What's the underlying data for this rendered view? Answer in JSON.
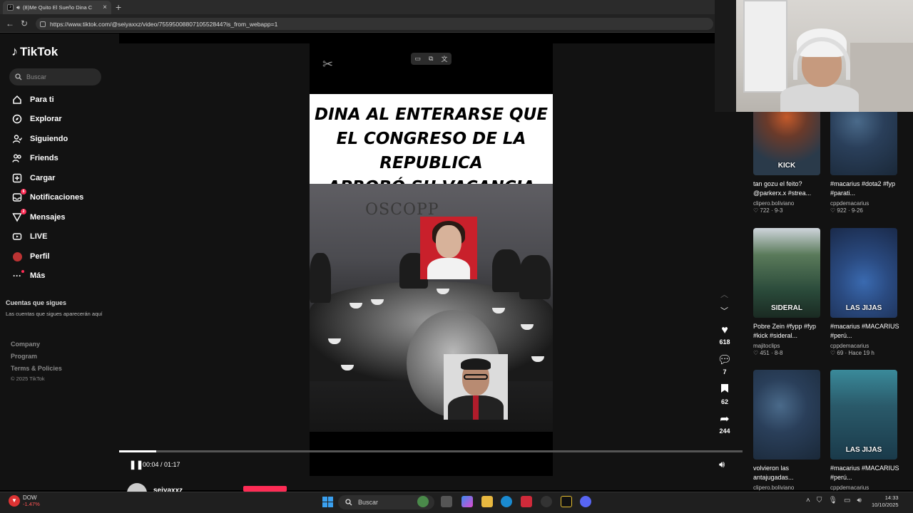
{
  "browser": {
    "tab_title": "(8)Me Quito El Sueño Dina C",
    "url": "https://www.tiktok.com/@seiyaxxz/video/7559500880710552844?is_from_webapp=1"
  },
  "sidebar": {
    "logo": "TikTok",
    "search_placeholder": "Buscar",
    "items": [
      {
        "label": "Para ti",
        "icon": "home-icon"
      },
      {
        "label": "Explorar",
        "icon": "compass-icon"
      },
      {
        "label": "Siguiendo",
        "icon": "following-icon"
      },
      {
        "label": "Friends",
        "icon": "friends-icon"
      },
      {
        "label": "Cargar",
        "icon": "upload-icon"
      },
      {
        "label": "Notificaciones",
        "icon": "inbox-icon",
        "badge": "6"
      },
      {
        "label": "Mensajes",
        "icon": "message-icon",
        "badge": "2"
      },
      {
        "label": "LIVE",
        "icon": "live-icon"
      },
      {
        "label": "Perfil",
        "icon": "avatar-icon"
      },
      {
        "label": "Más",
        "icon": "more-icon"
      }
    ],
    "following_title": "Cuentas que sigues",
    "following_note": "Las cuentas que sigues aparecerán aquí",
    "footer": [
      "Company",
      "Program",
      "Terms & Policies"
    ],
    "copyright": "© 2025 TikTok"
  },
  "video": {
    "caption_lines": [
      "DINA AL ENTERARSE QUE",
      "EL CONGRESO DE LA REPUBLICA",
      "APROBÓ SU VACANCIA"
    ],
    "sign_text": "OSCOPP",
    "time": "00:04 / 01:17",
    "progress": 0.06,
    "author": "seiyaxxz"
  },
  "actions": {
    "likes": "618",
    "comments": "7",
    "saves": "62",
    "shares": "244"
  },
  "recommendations": [
    {
      "title": "tan gozu el feito? @parkerx.x #strea...",
      "author": "clipero.boliviano",
      "meta": "♡ 722 · 9-3",
      "thumb_label": "KICK",
      "style": "thumb-fire"
    },
    {
      "title": "#macarius #dota2 #fyp #parati...",
      "author": "cppdemacarius",
      "meta": "♡ 922 · 9-26",
      "thumb_label": "",
      "style": "thumb-game"
    },
    {
      "title": "Pobre Zein #fypp #fyp #kick #sideral...",
      "author": "majitoclips",
      "meta": "♡ 451 · 8-8",
      "thumb_label": "SIDERAL",
      "style": "thumb-green"
    },
    {
      "title": "#macarius #MACARIUS #perú...",
      "author": "cppdemacarius",
      "meta": "♡ 69 · Hace 19 h",
      "thumb_label": "LAS JIJAS",
      "style": "thumb-blue"
    },
    {
      "title": "volvieron las antajugadas...",
      "author": "clipero.boliviano",
      "meta": "",
      "thumb_label": "",
      "style": "thumb-game"
    },
    {
      "title": "#macarius #MACARIUS #perú...",
      "author": "cppdemacarius",
      "meta": "",
      "thumb_label": "LAS JIJAS",
      "style": "thumb-people"
    }
  ],
  "taskbar": {
    "stock_name": "DOW",
    "stock_change": "-1.47%",
    "search_placeholder": "Buscar",
    "time": "14:33",
    "date": "10/10/2025"
  },
  "colors": {
    "accent": "#fe2c55",
    "background": "#121212"
  }
}
